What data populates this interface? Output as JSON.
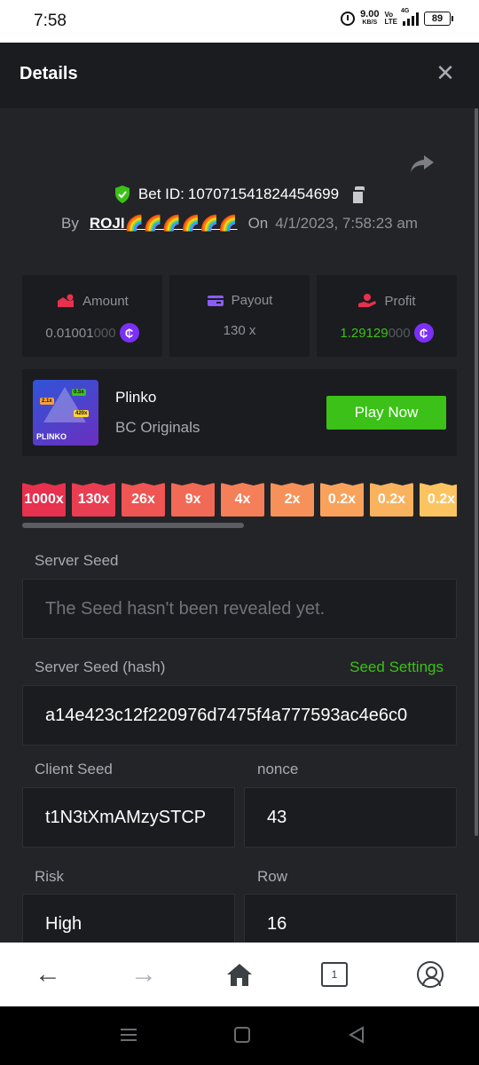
{
  "status_bar": {
    "time": "7:58",
    "net_speed": "9.00",
    "net_speed_unit": "KB/S",
    "volte_top": "Vo",
    "volte_bottom": "LTE",
    "network": "4G",
    "battery": "89"
  },
  "header": {
    "title": "Details"
  },
  "bet": {
    "label": "Bet ID:",
    "id": "107071541824454699",
    "by_label": "By",
    "user": "ROJI🌈🌈🌈🌈🌈🌈",
    "on_label": "On",
    "date": "4/1/2023, 7:58:23 am"
  },
  "stats": {
    "amount": {
      "label": "Amount",
      "value": "0.01001",
      "value_dim": "000"
    },
    "payout": {
      "label": "Payout",
      "value": "130 x"
    },
    "profit": {
      "label": "Profit",
      "value": "1.29129",
      "value_dim": "000"
    },
    "coin_symbol": "₵",
    "coin_color": "#7b2ff7"
  },
  "game": {
    "name": "Plinko",
    "category": "BC Originals",
    "play_label": "Play Now",
    "thumb_brand": "PLINKO",
    "thumb_tags": [
      "2.1x",
      "0.5x",
      "420x"
    ]
  },
  "multipliers": [
    {
      "label": "1000x",
      "color": "#e8304f"
    },
    {
      "label": "130x",
      "color": "#e93d52"
    },
    {
      "label": "26x",
      "color": "#ee5553"
    },
    {
      "label": "9x",
      "color": "#f16a55"
    },
    {
      "label": "4x",
      "color": "#f47f58"
    },
    {
      "label": "2x",
      "color": "#f6915a"
    },
    {
      "label": "0.2x",
      "color": "#f8a25c"
    },
    {
      "label": "0.2x",
      "color": "#f9b25e"
    },
    {
      "label": "0.2x",
      "color": "#fbc460"
    }
  ],
  "fields": {
    "server_seed": {
      "label": "Server Seed",
      "value": "The Seed hasn't been revealed yet."
    },
    "server_seed_hash": {
      "label": "Server Seed (hash)",
      "link": "Seed Settings",
      "value": "a14e423c12f220976d7475f4a777593ac4e6c0"
    },
    "client_seed": {
      "label": "Client Seed",
      "value": "t1N3tXmAMzySTCP"
    },
    "nonce": {
      "label": "nonce",
      "value": "43"
    },
    "risk": {
      "label": "Risk",
      "value": "High"
    },
    "row": {
      "label": "Row",
      "value": "16"
    }
  },
  "browser_nav": {
    "tab_count": "1"
  },
  "colors": {
    "accent": "#3bc117",
    "background": "#232427",
    "panel": "#1b1c1f"
  }
}
